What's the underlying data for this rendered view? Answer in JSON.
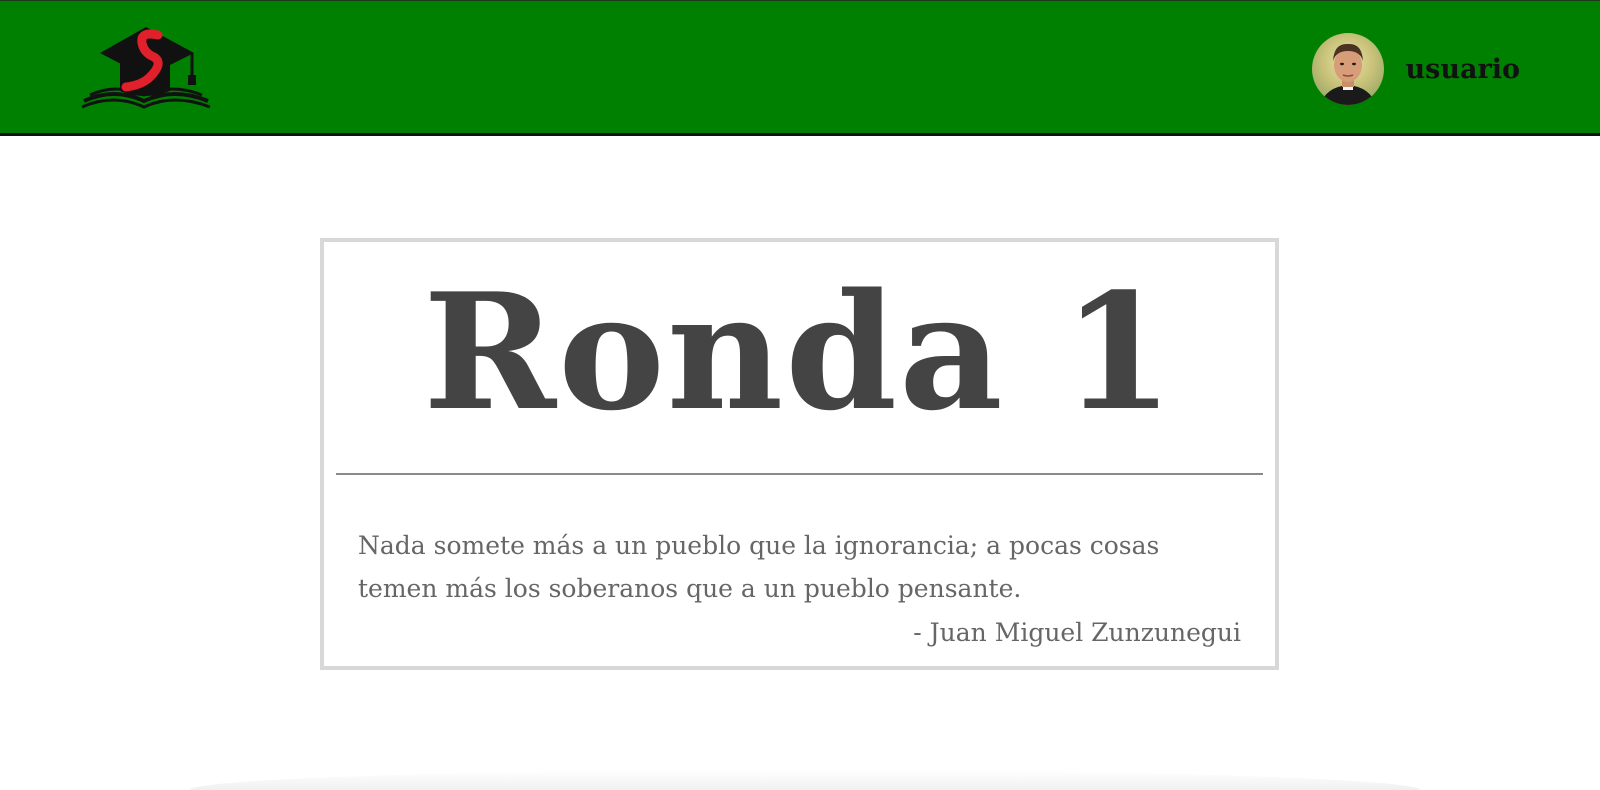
{
  "header": {
    "logo_icon": "graduation-cap-book-logo",
    "user": {
      "name": "usuario",
      "avatar_icon": "user-avatar-portrait"
    },
    "colors": {
      "bar": "#008000",
      "bar_border": "#111111"
    }
  },
  "round_card": {
    "title": "Ronda 1",
    "quote": "Nada somete más a un pueblo que la ignorancia; a pocas cosas temen más los soberanos que a un pueblo pensante.",
    "author": "- Juan Miguel Zunzunegui",
    "colors": {
      "title": "#444444",
      "text": "#666666",
      "border": "#d8d8d8"
    }
  }
}
